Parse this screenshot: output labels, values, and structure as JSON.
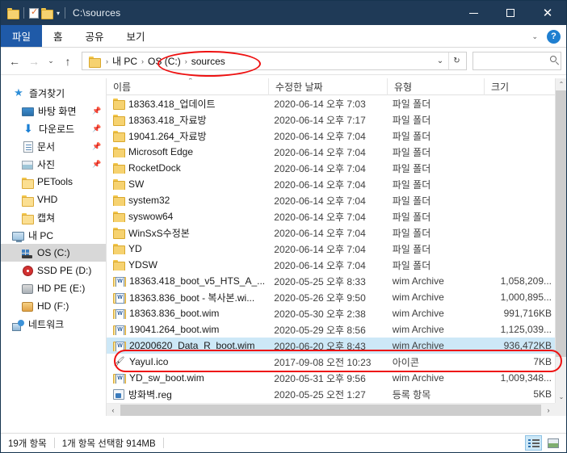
{
  "titlebar": {
    "title": "C:\\sources",
    "quick_access": [
      {
        "name": "folder-icon",
        "label": ""
      },
      {
        "name": "properties-icon",
        "label": ""
      },
      {
        "name": "new-folder-icon",
        "label": ""
      }
    ],
    "customize_caret": "▾",
    "minimize": "—",
    "maximize": "□",
    "close": "✕"
  },
  "ribbon": {
    "tabs": [
      {
        "label": "파일",
        "active": true
      },
      {
        "label": "홈",
        "active": false
      },
      {
        "label": "공유",
        "active": false
      },
      {
        "label": "보기",
        "active": false
      }
    ],
    "expand_caret": "⌄",
    "help_label": "?"
  },
  "address": {
    "back": "←",
    "forward": "→",
    "recent_caret": "⌄",
    "up": "↑",
    "breadcrumbs": [
      "내 PC",
      "OS (C:)",
      "sources"
    ],
    "separator": "›",
    "dropdown_caret": "⌄",
    "refresh": "↻",
    "search_placeholder": "",
    "search_value": ""
  },
  "sidebar": {
    "items": [
      {
        "label": "즐겨찾기",
        "icon": "star-icon",
        "level": 0,
        "pinned": false,
        "selected": false
      },
      {
        "label": "바탕 화면",
        "icon": "desktop-icon",
        "level": 1,
        "pinned": true,
        "selected": false
      },
      {
        "label": "다운로드",
        "icon": "download-icon",
        "level": 1,
        "pinned": true,
        "selected": false
      },
      {
        "label": "문서",
        "icon": "document-icon",
        "level": 1,
        "pinned": true,
        "selected": false
      },
      {
        "label": "사진",
        "icon": "pictures-icon",
        "level": 1,
        "pinned": true,
        "selected": false
      },
      {
        "label": "PETools",
        "icon": "folder-icon",
        "level": 1,
        "pinned": false,
        "selected": false
      },
      {
        "label": "VHD",
        "icon": "folder-icon",
        "level": 1,
        "pinned": false,
        "selected": false
      },
      {
        "label": "캡쳐",
        "icon": "folder-icon",
        "level": 1,
        "pinned": false,
        "selected": false
      },
      {
        "label": "내 PC",
        "icon": "this-pc-icon",
        "level": 0,
        "pinned": false,
        "selected": false
      },
      {
        "label": "OS (C:)",
        "icon": "os-drive-icon",
        "level": 1,
        "pinned": false,
        "selected": true
      },
      {
        "label": "SSD PE (D:)",
        "icon": "cd-drive-icon",
        "level": 1,
        "pinned": false,
        "selected": false
      },
      {
        "label": "HD PE (E:)",
        "icon": "hdd-icon",
        "level": 1,
        "pinned": false,
        "selected": false
      },
      {
        "label": "HD (F:)",
        "icon": "hdd-orange-icon",
        "level": 1,
        "pinned": false,
        "selected": false
      },
      {
        "label": "네트워크",
        "icon": "network-icon",
        "level": 0,
        "pinned": false,
        "selected": false
      }
    ],
    "pin_glyph": "📌"
  },
  "filelist": {
    "columns": [
      {
        "label": "이름",
        "key": "name",
        "sorted": true,
        "sort_caret": "⌃"
      },
      {
        "label": "수정한 날짜",
        "key": "date",
        "sorted": false,
        "sort_caret": ""
      },
      {
        "label": "유형",
        "key": "type",
        "sorted": false,
        "sort_caret": ""
      },
      {
        "label": "크기",
        "key": "size",
        "sorted": false,
        "sort_caret": ""
      }
    ],
    "rows": [
      {
        "name": "18363.418_업데이트",
        "date": "2020-06-14 오후 7:03",
        "type": "파일 폴더",
        "size": "",
        "icon": "folder-icon",
        "selected": false
      },
      {
        "name": "18363.418_자료방",
        "date": "2020-06-14 오후 7:17",
        "type": "파일 폴더",
        "size": "",
        "icon": "folder-icon",
        "selected": false
      },
      {
        "name": "19041.264_자료방",
        "date": "2020-06-14 오후 7:04",
        "type": "파일 폴더",
        "size": "",
        "icon": "folder-icon",
        "selected": false
      },
      {
        "name": "Microsoft Edge",
        "date": "2020-06-14 오후 7:04",
        "type": "파일 폴더",
        "size": "",
        "icon": "folder-icon",
        "selected": false
      },
      {
        "name": "RocketDock",
        "date": "2020-06-14 오후 7:04",
        "type": "파일 폴더",
        "size": "",
        "icon": "folder-icon",
        "selected": false
      },
      {
        "name": "SW",
        "date": "2020-06-14 오후 7:04",
        "type": "파일 폴더",
        "size": "",
        "icon": "folder-icon",
        "selected": false
      },
      {
        "name": "system32",
        "date": "2020-06-14 오후 7:04",
        "type": "파일 폴더",
        "size": "",
        "icon": "folder-icon",
        "selected": false
      },
      {
        "name": "syswow64",
        "date": "2020-06-14 오후 7:04",
        "type": "파일 폴더",
        "size": "",
        "icon": "folder-icon",
        "selected": false
      },
      {
        "name": "WinSxS수정본",
        "date": "2020-06-14 오후 7:04",
        "type": "파일 폴더",
        "size": "",
        "icon": "folder-icon",
        "selected": false
      },
      {
        "name": "YD",
        "date": "2020-06-14 오후 7:04",
        "type": "파일 폴더",
        "size": "",
        "icon": "folder-icon",
        "selected": false
      },
      {
        "name": "YDSW",
        "date": "2020-06-14 오후 7:04",
        "type": "파일 폴더",
        "size": "",
        "icon": "folder-icon",
        "selected": false
      },
      {
        "name": "18363.418_boot_v5_HTS_A_...",
        "date": "2020-05-25 오후 8:33",
        "type": "wim Archive",
        "size": "1,058,209...",
        "icon": "wim-icon",
        "selected": false
      },
      {
        "name": "18363.836_boot - 복사본.wi...",
        "date": "2020-05-26 오후 9:50",
        "type": "wim Archive",
        "size": "1,000,895...",
        "icon": "wim-icon",
        "selected": false
      },
      {
        "name": "18363.836_boot.wim",
        "date": "2020-05-30 오후 2:38",
        "type": "wim Archive",
        "size": "991,716KB",
        "icon": "wim-icon",
        "selected": false
      },
      {
        "name": "19041.264_boot.wim",
        "date": "2020-05-29 오후 8:56",
        "type": "wim Archive",
        "size": "1,125,039...",
        "icon": "wim-icon",
        "selected": false
      },
      {
        "name": "20200620_Data_R_boot.wim",
        "date": "2020-06-20 오후 8:43",
        "type": "wim Archive",
        "size": "936,472KB",
        "icon": "wim-icon",
        "selected": true
      },
      {
        "name": "YayuI.ico",
        "date": "2017-09-08 오전 10:23",
        "type": "아이콘",
        "size": "7KB",
        "icon": "ico-file-icon",
        "selected": false
      },
      {
        "name": "YD_sw_boot.wim",
        "date": "2020-05-31 오후 9:56",
        "type": "wim Archive",
        "size": "1,009,348...",
        "icon": "wim-icon",
        "selected": false
      },
      {
        "name": "방화벽.reg",
        "date": "2020-05-25 오전 1:27",
        "type": "등록 항목",
        "size": "5KB",
        "icon": "reg-file-icon",
        "selected": false
      }
    ]
  },
  "scrollbars": {
    "v_up": "⌃",
    "v_down": "⌄",
    "h_left": "‹",
    "h_right": "›"
  },
  "statusbar": {
    "item_count": "19개 항목",
    "selection": "1개 항목 선택함  914MB",
    "view_details": "details-view",
    "view_thumbs": "thumbnails-view"
  },
  "annotations": {
    "accent_color": "#ee1111",
    "highlight_breadcrumb": "OS (C:) › sources",
    "highlight_row": "20200620_Data_R_boot.wim"
  }
}
